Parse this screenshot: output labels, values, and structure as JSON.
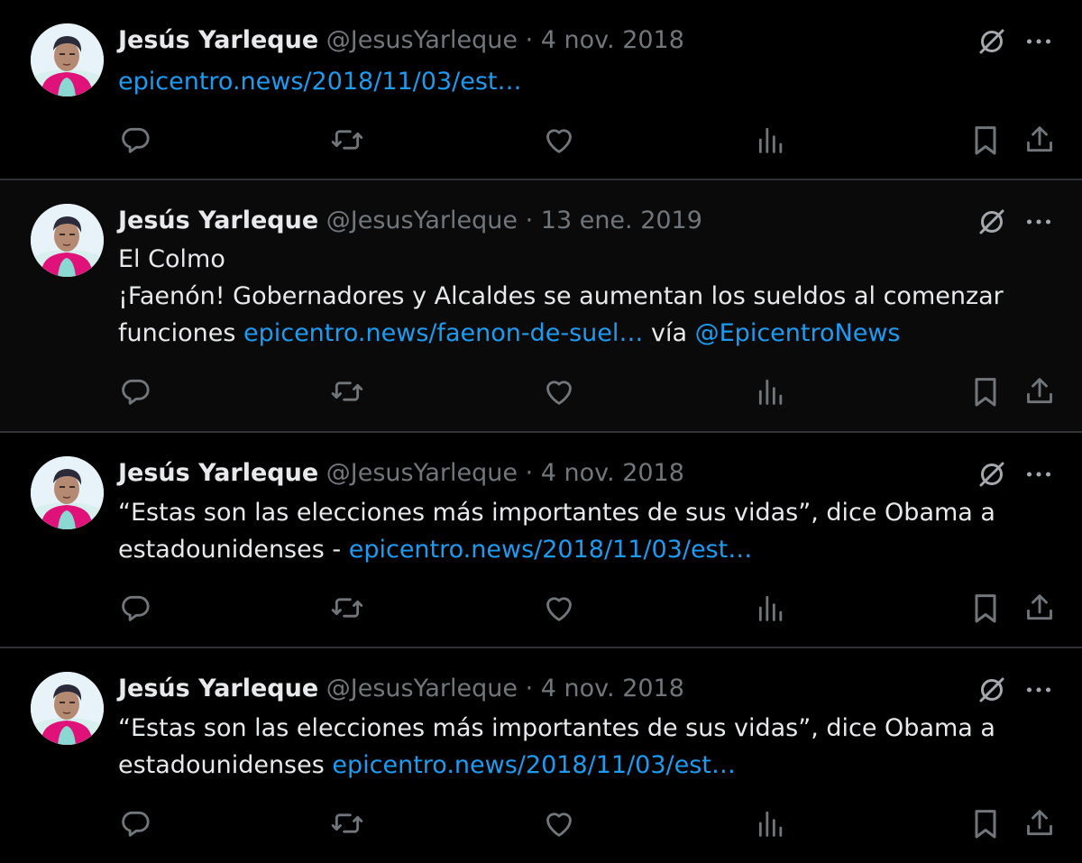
{
  "colors": {
    "background": "#000000",
    "text": "#e7e9ea",
    "muted": "#71767b",
    "link": "#1d9bf0",
    "divider": "#2f3336"
  },
  "tweets": [
    {
      "name": "Jesús Yarleque",
      "handle": "@JesusYarleque",
      "dot": "·",
      "date": "4 nov. 2018",
      "lines": [
        {
          "parts": [
            {
              "type": "link",
              "text": "epicentro.news/2018/11/03/est…"
            }
          ]
        }
      ]
    },
    {
      "name": "Jesús Yarleque",
      "handle": "@JesusYarleque",
      "dot": "·",
      "date": "13 ene. 2019",
      "lines": [
        {
          "parts": [
            {
              "type": "text",
              "text": "El Colmo"
            }
          ]
        },
        {
          "parts": [
            {
              "type": "text",
              "text": "¡Faenón! Gobernadores y Alcaldes se aumentan los sueldos al comenzar"
            }
          ]
        },
        {
          "parts": [
            {
              "type": "text",
              "text": "funciones "
            },
            {
              "type": "link",
              "text": "epicentro.news/faenon-de-suel…"
            },
            {
              "type": "text",
              "text": " vía "
            },
            {
              "type": "link",
              "text": "@EpicentroNews"
            }
          ]
        }
      ]
    },
    {
      "name": "Jesús Yarleque",
      "handle": "@JesusYarleque",
      "dot": "·",
      "date": "4 nov. 2018",
      "lines": [
        {
          "parts": [
            {
              "type": "text",
              "text": "“Estas son las elecciones más importantes de sus vidas”, dice Obama a"
            }
          ]
        },
        {
          "parts": [
            {
              "type": "text",
              "text": "estadounidenses - "
            },
            {
              "type": "link",
              "text": "epicentro.news/2018/11/03/est…"
            }
          ]
        }
      ]
    },
    {
      "name": "Jesús Yarleque",
      "handle": "@JesusYarleque",
      "dot": "·",
      "date": "4 nov. 2018",
      "lines": [
        {
          "parts": [
            {
              "type": "text",
              "text": "“Estas son las elecciones más importantes de sus vidas”, dice Obama a"
            }
          ]
        },
        {
          "parts": [
            {
              "type": "text",
              "text": "estadounidenses  "
            },
            {
              "type": "link",
              "text": "epicentro.news/2018/11/03/est…"
            }
          ]
        }
      ]
    }
  ],
  "icons": {
    "grok": "grok-icon",
    "more": "more-icon",
    "reply": "reply-icon",
    "retweet": "retweet-icon",
    "like": "like-icon",
    "views": "views-icon",
    "bookmark": "bookmark-icon",
    "share": "share-icon"
  }
}
